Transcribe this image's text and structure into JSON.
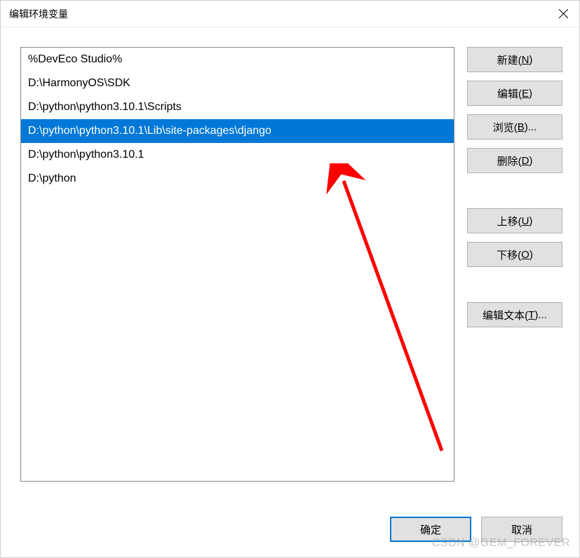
{
  "window": {
    "title": "编辑环境变量"
  },
  "list": {
    "items": [
      {
        "text": "%DevEco Studio%",
        "selected": false
      },
      {
        "text": "D:\\HarmonyOS\\SDK",
        "selected": false
      },
      {
        "text": "D:\\python\\python3.10.1\\Scripts",
        "selected": false
      },
      {
        "text": "D:\\python\\python3.10.1\\Lib\\site-packages\\django",
        "selected": true
      },
      {
        "text": "D:\\python\\python3.10.1",
        "selected": false
      },
      {
        "text": "D:\\python",
        "selected": false
      }
    ]
  },
  "buttons": {
    "new": {
      "label": "新建(",
      "mn": "N",
      "tail": ")"
    },
    "edit": {
      "label": "编辑(",
      "mn": "E",
      "tail": ")"
    },
    "browse": {
      "label": "浏览(",
      "mn": "B",
      "tail": ")..."
    },
    "delete": {
      "label": "删除(",
      "mn": "D",
      "tail": ")"
    },
    "up": {
      "label": "上移(",
      "mn": "U",
      "tail": ")"
    },
    "down": {
      "label": "下移(",
      "mn": "O",
      "tail": ")"
    },
    "text": {
      "label": "编辑文本(",
      "mn": "T",
      "tail": ")..."
    },
    "ok": {
      "label": "确定"
    },
    "cancel": {
      "label": "取消"
    }
  },
  "watermark": "CSDN @GEM_FOREVER",
  "annotation": {
    "arrow_color": "#ff0000"
  }
}
